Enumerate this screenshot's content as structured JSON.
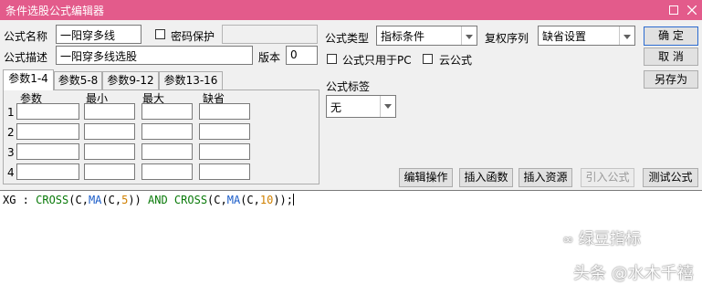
{
  "window": {
    "title": "条件选股公式编辑器"
  },
  "form": {
    "name_label": "公式名称",
    "name_value": "一阳穿多线",
    "password_label": "密码保护",
    "desc_label": "公式描述",
    "desc_value": "一阳穿多线选股",
    "version_label": "版本",
    "version_value": "0",
    "type_label": "公式类型",
    "type_value": "指标条件",
    "restore_label": "复权序列",
    "restore_value": "缺省设置",
    "pc_only_label": "公式只用于PC",
    "cloud_label": "云公式",
    "tag_label": "公式标签",
    "tag_value": "无"
  },
  "buttons": {
    "ok": "确  定",
    "cancel": "取  消",
    "save_as": "另存为",
    "edit_op": "编辑操作",
    "insert_func": "插入函数",
    "insert_res": "插入资源",
    "import_formula": "引入公式",
    "test_formula": "测试公式"
  },
  "tabs": [
    "参数1-4",
    "参数5-8",
    "参数9-12",
    "参数13-16"
  ],
  "params": {
    "columns": [
      "参数",
      "最小",
      "最大",
      "缺省"
    ],
    "rows": [
      "1",
      "2",
      "3",
      "4"
    ]
  },
  "code": {
    "t1": "XG : ",
    "t2": "CROSS",
    "t3": "(C,",
    "t4": "MA",
    "t5": "(C,",
    "t6": "5",
    "t7": ")) ",
    "t8": "AND",
    "t9": " ",
    "t10": "CROSS",
    "t11": "(C,",
    "t12": "MA",
    "t13": "(C,",
    "t14": "10",
    "t15": "));"
  },
  "watermark": {
    "line1": "绿豆指标",
    "line2": "头条 @水木千禧"
  },
  "colors": {
    "titlebar": "#e35b8b",
    "keyword": "#0a7a0a",
    "function": "#1a5cc8",
    "number": "#d08000"
  }
}
